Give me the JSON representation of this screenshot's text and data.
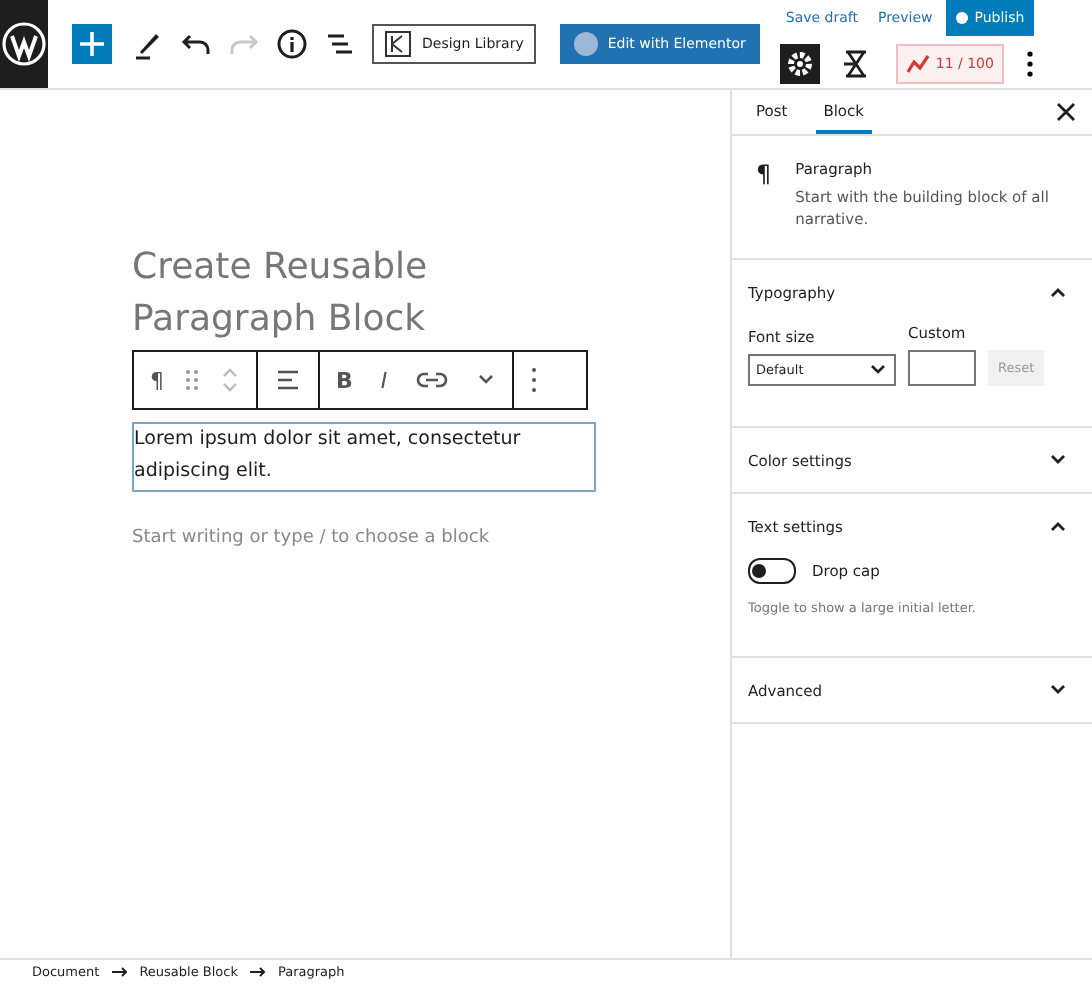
{
  "toolbar": {
    "inserter_active": true,
    "redo_disabled": true,
    "design_library": "Design Library",
    "elementor": "Edit with Elementor",
    "save_draft": "Save draft",
    "preview": "Preview",
    "publish": "Publish",
    "settings_active": true,
    "score": "11 / 100"
  },
  "editor": {
    "title": "Create Reusable Paragraph Block",
    "block_toolbar": {
      "paragraph": "¶",
      "bold": "B",
      "italic": "I"
    },
    "paragraph": "Lorem ipsum dolor sit amet, consectetur adipiscing elit.",
    "placeholder": "Start writing or type / to choose a block"
  },
  "sidebar": {
    "tabs": [
      {
        "label": "Post",
        "selected": false
      },
      {
        "label": "Block",
        "selected": true
      }
    ],
    "block_card": {
      "icon": "¶",
      "title": "Paragraph",
      "description": "Start with the building block of all narrative."
    },
    "panels": [
      {
        "kind": "typography",
        "title": "Typography",
        "expanded": true,
        "font_size_label": "Font size",
        "custom_label": "Custom",
        "font_size_value": "Default",
        "reset": "Reset"
      },
      {
        "kind": "plain",
        "title": "Color settings",
        "expanded": false
      },
      {
        "kind": "text",
        "title": "Text settings",
        "expanded": true,
        "toggle_label": "Drop cap",
        "toggle_on": false,
        "help": "Toggle to show a large initial letter."
      },
      {
        "kind": "plain",
        "title": "Advanced",
        "expanded": false
      }
    ]
  },
  "breadcrumb": [
    "Document",
    "Reusable Block",
    "Paragraph"
  ]
}
